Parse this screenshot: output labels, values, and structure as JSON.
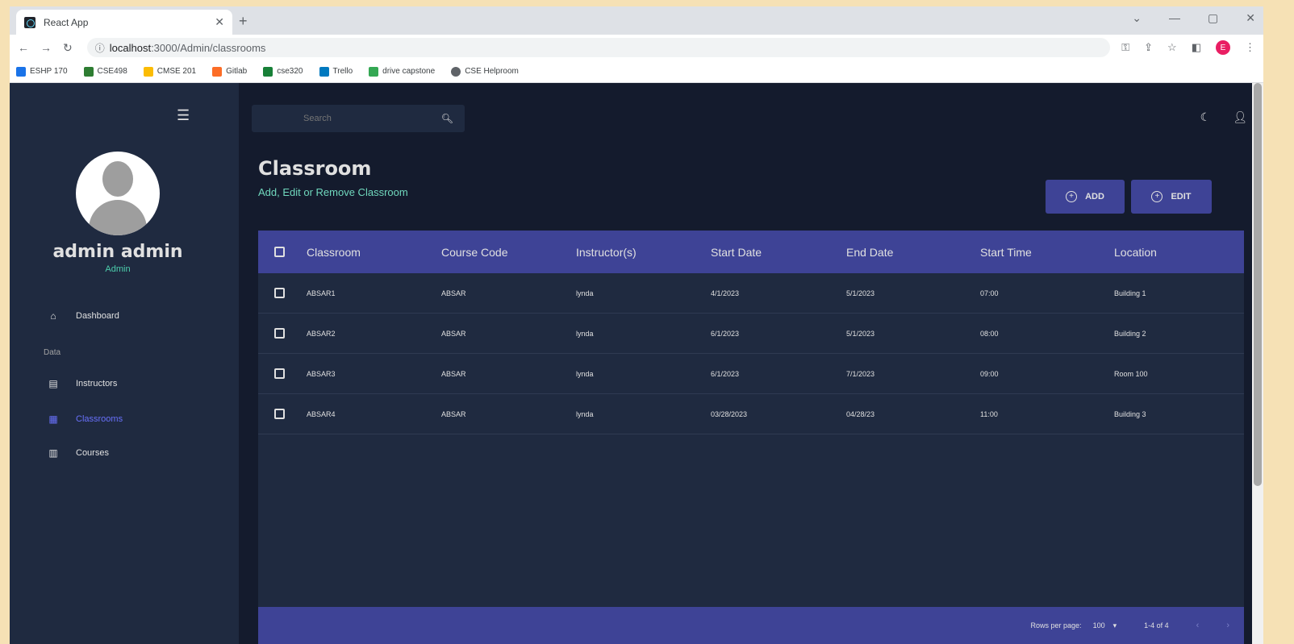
{
  "browser": {
    "tab_title": "React App",
    "url_host": "localhost",
    "url_path": ":3000/Admin/classrooms",
    "bookmarks": [
      {
        "label": "ESHP 170",
        "color": "#1a73e8"
      },
      {
        "label": "CSE498",
        "color": "#2e7d32"
      },
      {
        "label": "CMSE 201",
        "color": "#fbbc04"
      },
      {
        "label": "Gitlab",
        "color": "#fc6d26"
      },
      {
        "label": "cse320",
        "color": "#188038"
      },
      {
        "label": "Trello",
        "color": "#0079bf"
      },
      {
        "label": "drive capstone",
        "color": "#34a853"
      },
      {
        "label": "CSE Helproom",
        "color": "#5f6368"
      }
    ]
  },
  "sidebar": {
    "user_name": "admin admin",
    "user_role": "Admin",
    "section_data": "Data",
    "items": [
      {
        "label": "Dashboard",
        "icon": "home-icon"
      },
      {
        "label": "Instructors",
        "icon": "contacts-icon"
      },
      {
        "label": "Classrooms",
        "icon": "classroom-icon",
        "active": true
      },
      {
        "label": "Courses",
        "icon": "book-icon"
      }
    ]
  },
  "topbar": {
    "search_placeholder": "Search"
  },
  "header": {
    "title": "Classroom",
    "subtitle": "Add, Edit or Remove Classroom"
  },
  "actions": {
    "add_label": "ADD",
    "edit_label": "EDIT"
  },
  "table": {
    "columns": [
      "Classroom",
      "Course Code",
      "Instructor(s)",
      "Start Date",
      "End Date",
      "Start Time",
      "Location"
    ],
    "rows": [
      [
        "ABSAR1",
        "ABSAR",
        "lynda",
        "4/1/2023",
        "5/1/2023",
        "07:00",
        "Building 1"
      ],
      [
        "ABSAR2",
        "ABSAR",
        "lynda",
        "6/1/2023",
        "5/1/2023",
        "08:00",
        "Building 2"
      ],
      [
        "ABSAR3",
        "ABSAR",
        "lynda",
        "6/1/2023",
        "7/1/2023",
        "09:00",
        "Room 100"
      ],
      [
        "ABSAR4",
        "ABSAR",
        "lynda",
        "03/28/2023",
        "04/28/23",
        "11:00",
        "Building 3"
      ]
    ],
    "rows_per_page_label": "Rows per page:",
    "rows_per_page_value": "100",
    "pagination_range": "1-4 of 4"
  },
  "colors": {
    "primary": "#3e4396",
    "accent": "#4cceac",
    "background": "#141b2d",
    "panel": "#1f2a40"
  }
}
